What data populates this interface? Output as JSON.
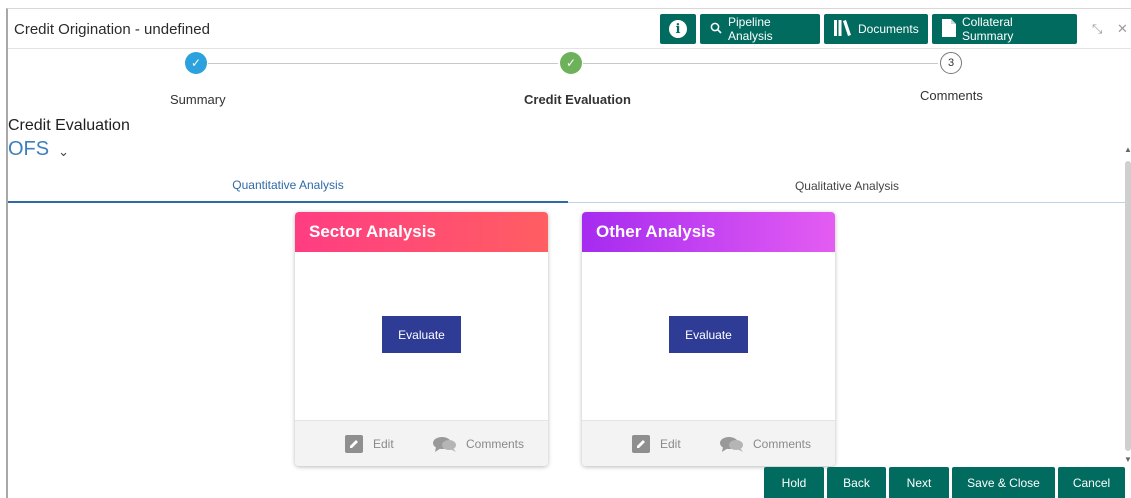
{
  "window": {
    "title": "Credit Origination - undefined"
  },
  "header_buttons": {
    "info_glyph": "i",
    "pipeline": "Pipeline Analysis",
    "documents": "Documents",
    "collateral": "Collateral Summary"
  },
  "window_controls": {
    "minimize_glyph": "⤡",
    "close_glyph": "✕"
  },
  "stepper": {
    "steps": [
      {
        "label": "Summary",
        "state": "done",
        "marker": "✓"
      },
      {
        "label": "Credit Evaluation",
        "state": "current",
        "marker": "✓"
      },
      {
        "label": "Comments",
        "state": "pending",
        "marker": "3"
      }
    ]
  },
  "section": {
    "title": "Credit Evaluation",
    "entity": "OFS",
    "chevron": "⌄"
  },
  "tabs": {
    "quantitative": "Quantitative Analysis",
    "qualitative": "Qualitative Analysis",
    "active": "quantitative"
  },
  "cards": [
    {
      "title": "Sector Analysis",
      "button": "Evaluate",
      "edit": "Edit",
      "comments": "Comments"
    },
    {
      "title": "Other Analysis",
      "button": "Evaluate",
      "edit": "Edit",
      "comments": "Comments"
    }
  ],
  "footer": {
    "hold": "Hold",
    "back": "Back",
    "next": "Next",
    "save_close": "Save & Close",
    "cancel": "Cancel"
  },
  "colors": {
    "header_button": "#006b5e",
    "step_done": "#2ba2dd",
    "step_current": "#6db25a",
    "tab_active": "#2f6aa8",
    "evaluate_button": "#2f3c95",
    "sector_header": "#ff3d83",
    "other_header": "#a62bf0"
  },
  "icons": {
    "pipeline": "search-icon",
    "documents": "library-icon",
    "collateral": "document-icon",
    "edit": "pencil-icon",
    "comments": "chat-bubbles-icon"
  }
}
